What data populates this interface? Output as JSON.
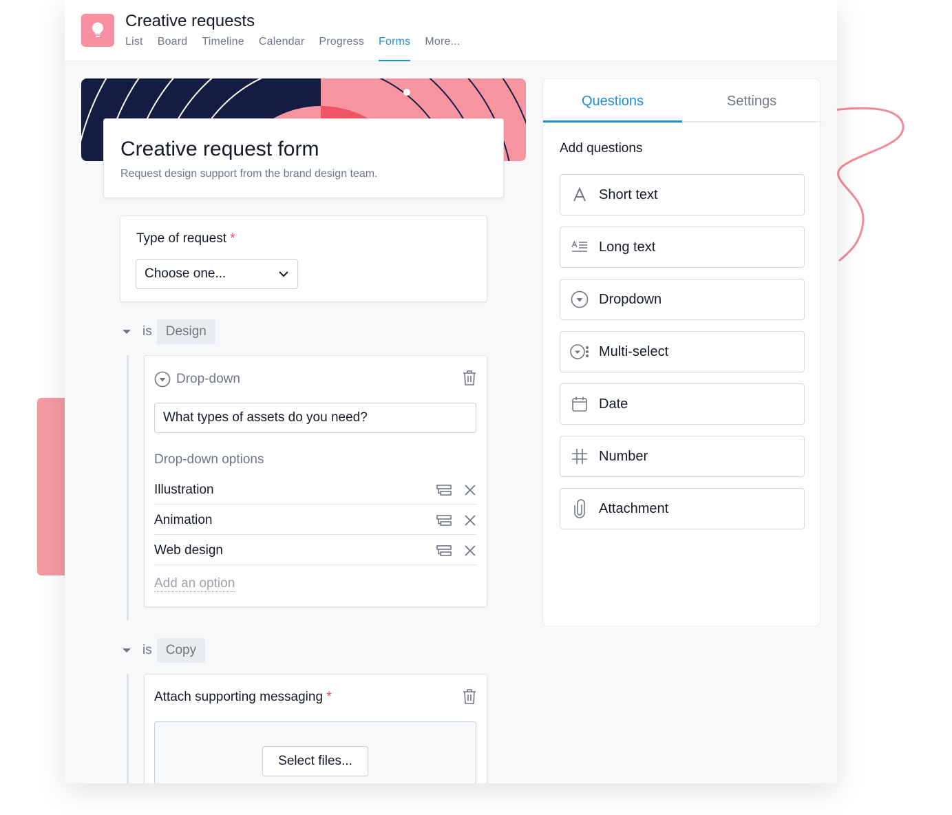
{
  "project": {
    "title": "Creative requests"
  },
  "tabs": [
    "List",
    "Board",
    "Timeline",
    "Calendar",
    "Progress",
    "Forms",
    "More..."
  ],
  "active_tab": "Forms",
  "form": {
    "title": "Creative request form",
    "description": "Request design support from the brand design team."
  },
  "type_question": {
    "label": "Type of request",
    "required_mark": "*",
    "select_value": "Choose one..."
  },
  "branch_design": {
    "is_text": "is",
    "tag": "Design"
  },
  "dropdown_field": {
    "type_label": "Drop-down",
    "question": "What types of assets do you need?",
    "options_title": "Drop-down options",
    "options": [
      "Illustration",
      "Animation",
      "Web design"
    ],
    "add_option": "Add an option"
  },
  "branch_copy": {
    "is_text": "is",
    "tag": "Copy"
  },
  "attachment_field": {
    "label": "Attach supporting messaging",
    "required_mark": "*",
    "button": "Select files..."
  },
  "panel": {
    "tabs": [
      "Questions",
      "Settings"
    ],
    "active_tab": "Questions",
    "heading": "Add questions",
    "question_types": [
      {
        "label": "Short text",
        "icon": "short-text-icon"
      },
      {
        "label": "Long text",
        "icon": "long-text-icon"
      },
      {
        "label": "Dropdown",
        "icon": "dropdown-icon"
      },
      {
        "label": "Multi-select",
        "icon": "multi-select-icon"
      },
      {
        "label": "Date",
        "icon": "calendar-icon"
      },
      {
        "label": "Number",
        "icon": "number-icon"
      },
      {
        "label": "Attachment",
        "icon": "paperclip-icon"
      }
    ]
  },
  "colors": {
    "accent": "#1f8dd6",
    "project_icon": "#f88fa0",
    "banner_navy": "#131d44",
    "banner_pink": "#f6959f",
    "banner_red": "#f05464",
    "required": "#ed4758"
  }
}
